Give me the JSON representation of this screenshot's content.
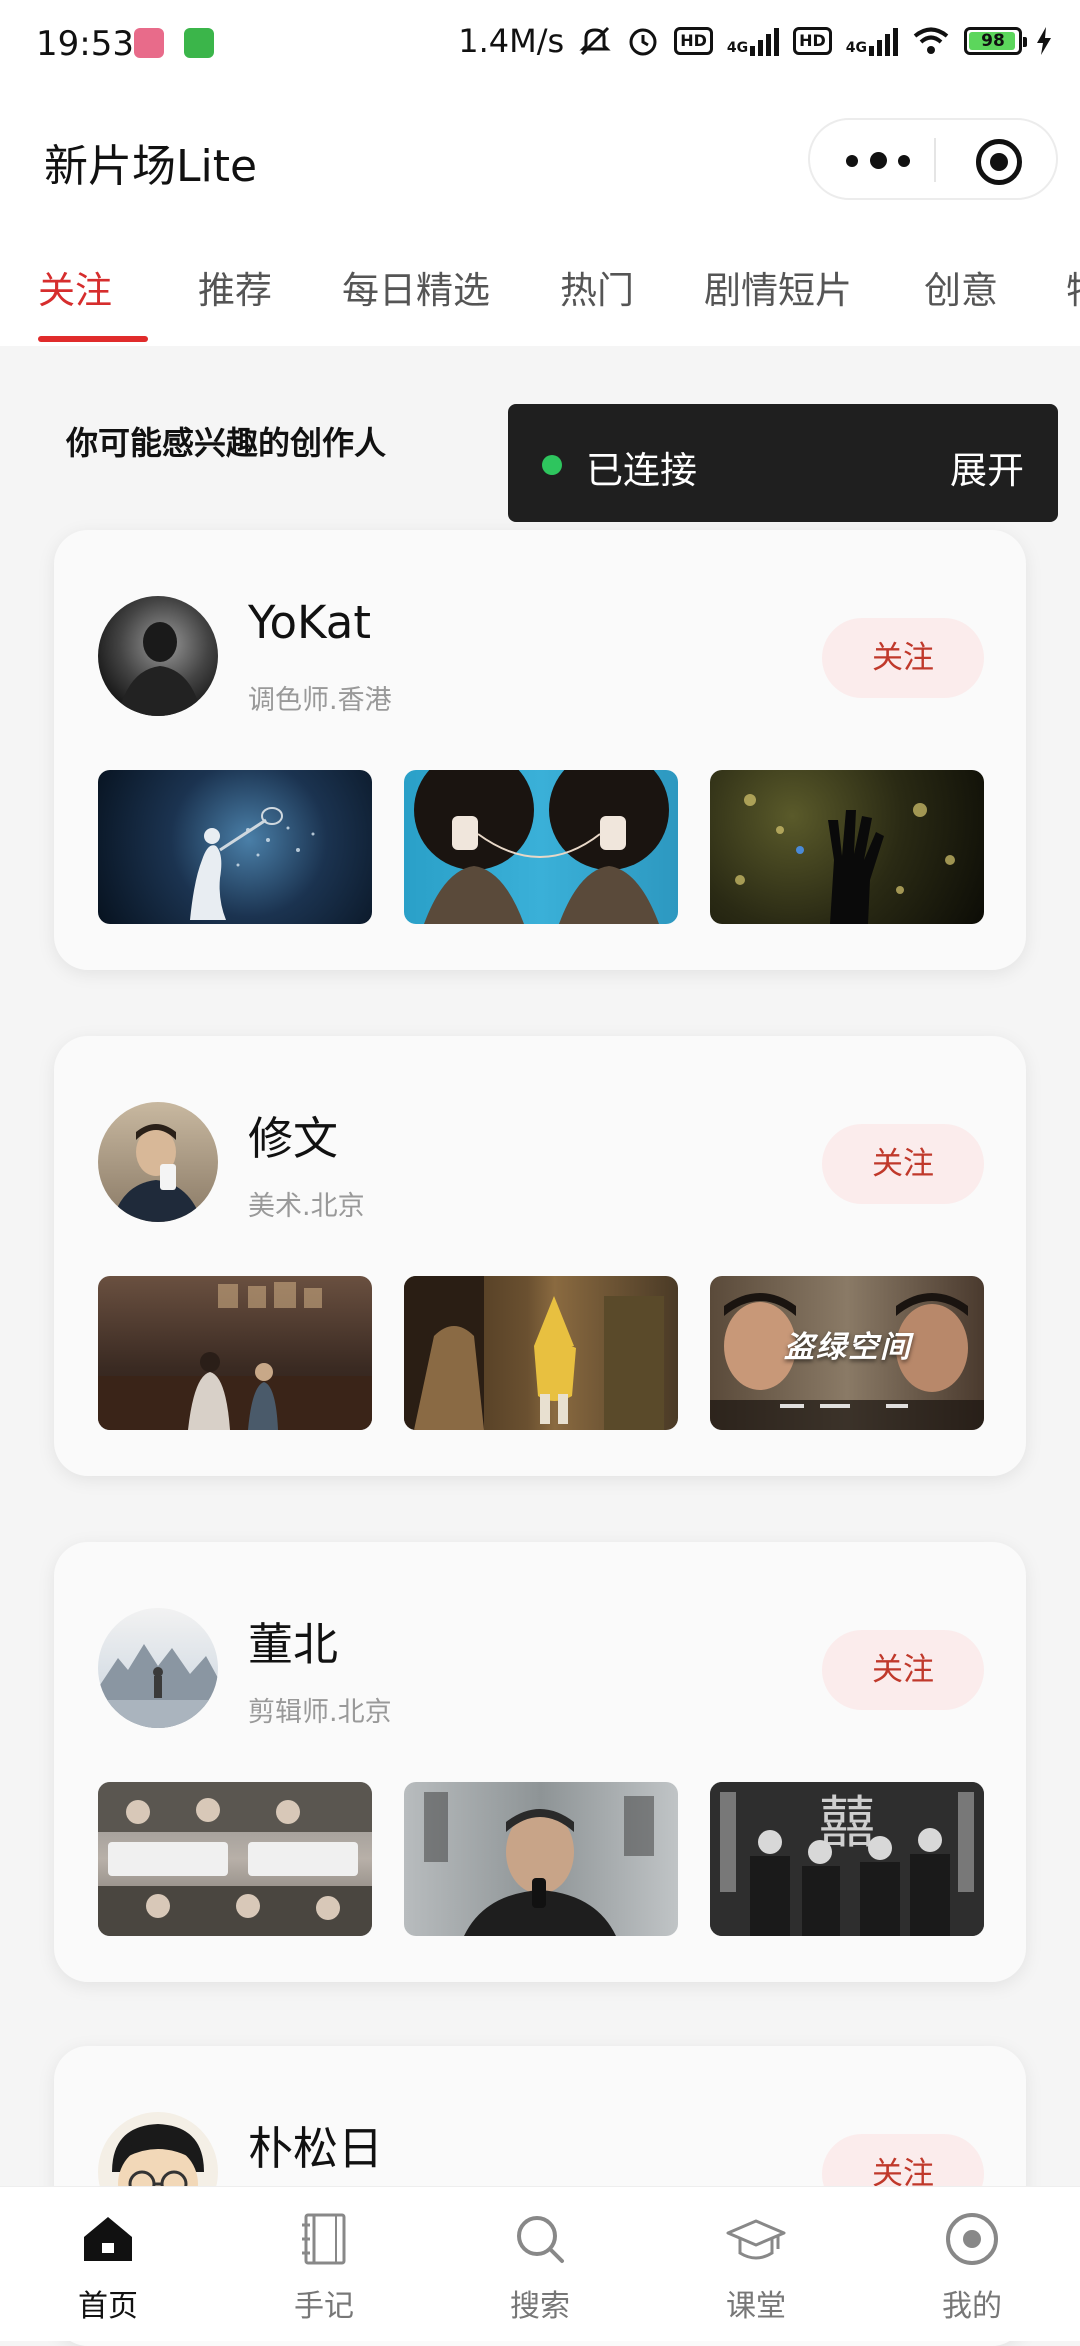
{
  "status_bar": {
    "time": "19:53",
    "network_speed": "1.4M/s",
    "net1": "4G",
    "net2": "4G",
    "hd": "HD",
    "battery": "98"
  },
  "header": {
    "title": "新片场Lite"
  },
  "tabs": [
    "关注",
    "推荐",
    "每日精选",
    "热门",
    "剧情短片",
    "创意",
    "特"
  ],
  "section": {
    "title": "你可能感兴趣的创作人"
  },
  "toast": {
    "status": "已连接",
    "action": "展开"
  },
  "creators": [
    {
      "name": "YoKat",
      "role": "调色师.香港",
      "follow_label": "关注"
    },
    {
      "name": "修文",
      "role": "美术.北京",
      "follow_label": "关注"
    },
    {
      "name": "董北",
      "role": "剪辑师.北京",
      "follow_label": "关注"
    },
    {
      "name": "朴松日",
      "role": "",
      "follow_label": "关注"
    }
  ],
  "thumb_overlays": {
    "poster_title": "盗绿空间"
  },
  "bottom_nav": [
    {
      "label": "首页",
      "icon": "home-icon"
    },
    {
      "label": "手记",
      "icon": "notebook-icon"
    },
    {
      "label": "搜索",
      "icon": "search-icon"
    },
    {
      "label": "课堂",
      "icon": "graduation-cap-icon"
    },
    {
      "label": "我的",
      "icon": "profile-circle-icon"
    }
  ],
  "colors": {
    "accent": "#e02b2b",
    "follow_bg": "#fbecec",
    "toast_bg": "#1f1f1f",
    "connected": "#2ec55e"
  }
}
